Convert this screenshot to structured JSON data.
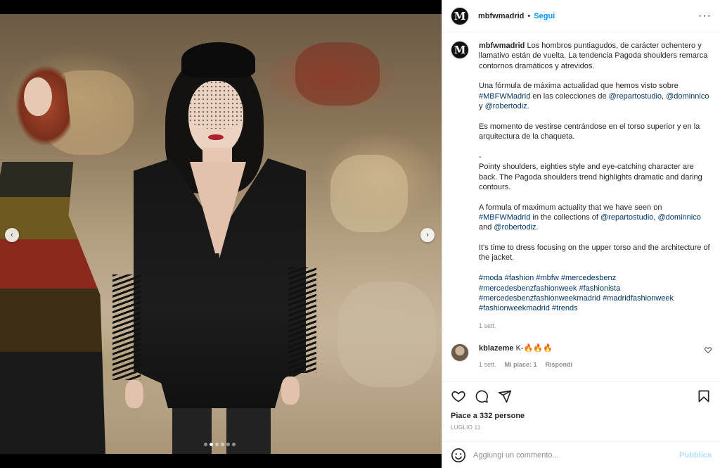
{
  "post": {
    "username": "mbfwmadrid",
    "avatar_letter": "M",
    "follow_label": "Segui",
    "separator": "•",
    "more_label": "···"
  },
  "caption": {
    "username": "mbfwmadrid",
    "p1": "Los hombros puntiagudos, de carácter ochentero y llamativo están de vuelta. La tendencia Pagoda shoulders remarca contornos dramáticos y atrevidos.",
    "p2_a": "Una fórmula de máxima actualidad que hemos visto sobre ",
    "p2_tag1": "#MBFWMadrid",
    "p2_b": " en las colecciones de ",
    "p2_tag2": "@repartostudio",
    "p2_c": ", ",
    "p2_tag3": "@dominnico",
    "p2_d": " y ",
    "p2_tag4": "@robertodiz",
    "p2_e": ".",
    "p3": "Es momento de vestirse centrándose en el torso superior y en la arquitectura de la chaqueta.",
    "p4": "-",
    "p5": "Pointy shoulders, eighties style and eye-catching character are back. The Pagoda shoulders trend highlights dramatic and daring contours.",
    "p6_a": "A formula of maximum actuality that we have seen on ",
    "p6_tag1": "#MBFWMadrid",
    "p6_b": " in the collections of ",
    "p6_tag2": "@repartostudio",
    "p6_c": ", ",
    "p6_tag3": "@dominnico",
    "p6_d": " and ",
    "p6_tag4": "@robertodiz",
    "p6_e": ".",
    "p7": "It's time to dress focusing on the upper torso and the architecture of the jacket.",
    "hashtags": [
      "#moda",
      "#fashion",
      "#mbfw",
      "#mercedesbenz",
      "#mercedesbenzfashionweek",
      "#fashionista",
      "#mercedesbenzfashionweekmadrid",
      "#madridfashionweek",
      "#fashionweekmadrid",
      "#trends"
    ],
    "time": "1 sett."
  },
  "comment": {
    "username": "kblazeme",
    "text": "K-🔥🔥🔥",
    "time": "1 sett.",
    "likes": "Mi piace: 1",
    "reply": "Rispondi"
  },
  "actions": {
    "likes_text": "Piace a 332 persone",
    "date": "LUGLIO 11"
  },
  "compose": {
    "placeholder": "Aggiungi un commento...",
    "publish": "Pubblica"
  },
  "carousel": {
    "prev": "‹",
    "next": "›",
    "slides": 6,
    "active": 1
  },
  "colors": {
    "link": "#0095f6",
    "tag": "#00376b",
    "muted": "#8e8e8e"
  }
}
